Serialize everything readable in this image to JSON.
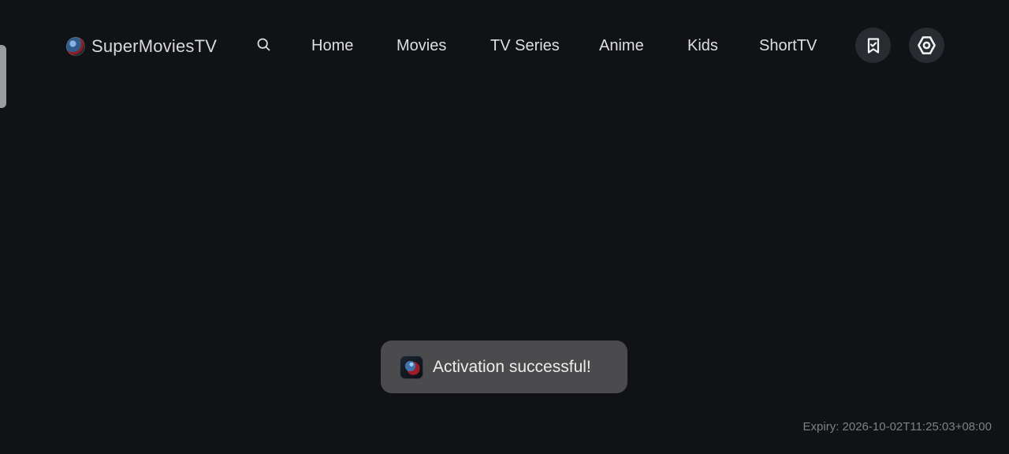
{
  "app": {
    "name": "SuperMoviesTV",
    "logo_icon": "app-logo-icon"
  },
  "header": {
    "search_icon": "search-icon",
    "nav": [
      {
        "label": "Home"
      },
      {
        "label": "Movies"
      },
      {
        "label": "TV Series"
      },
      {
        "label": "Anime"
      },
      {
        "label": "Kids"
      },
      {
        "label": "ShortTV"
      }
    ],
    "actions": {
      "watchlist_icon": "bookmark-check-icon",
      "settings_icon": "settings-icon"
    }
  },
  "toast": {
    "message": "Activation successful!",
    "icon": "app-logo-icon"
  },
  "footer": {
    "expiry": "Expiry: 2026-10-02T11:25:03+08:00"
  },
  "colors": {
    "background": "#111216",
    "header_text": "#dedfe2",
    "button_bg": "#2a2b30",
    "toast_bg": "#4b4b4d",
    "expiry_text": "#7f8084"
  }
}
